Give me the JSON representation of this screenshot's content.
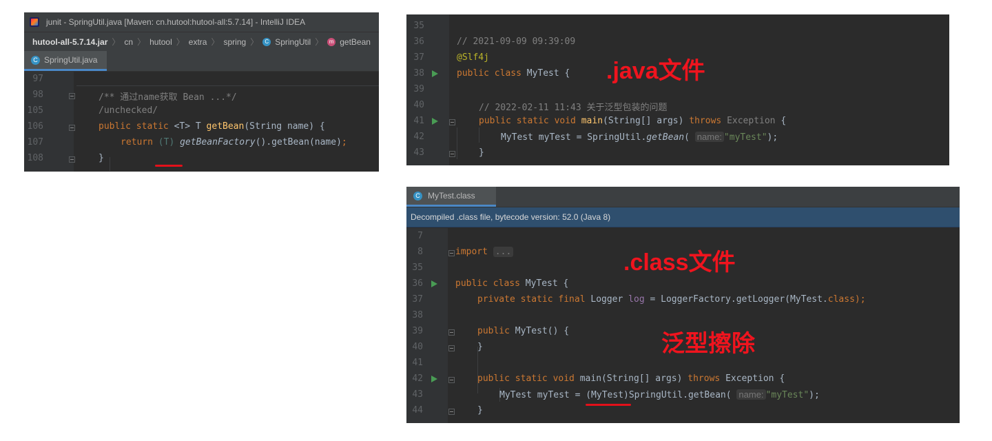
{
  "panel1": {
    "window_title": "junit - SpringUtil.java [Maven: cn.hutool:hutool-all:5.7.14] - IntelliJ IDEA",
    "breadcrumbs": [
      "hutool-all-5.7.14.jar",
      "cn",
      "hutool",
      "extra",
      "spring",
      "SpringUtil",
      "getBean"
    ],
    "tab_label": "SpringUtil.java",
    "lines": [
      {
        "num": "97"
      },
      {
        "num": "98",
        "comment": "/** 通过name获取 Bean ...*/"
      },
      {
        "num": "105",
        "comment": "/unchecked/"
      },
      {
        "num": "106",
        "kw1": "public static ",
        "gen": "<T>",
        "type": " T ",
        "fn": "getBean",
        "rest": "(String name) {"
      },
      {
        "num": "107",
        "kw": "return ",
        "cast": "(T) ",
        "it": "getBeanFactory",
        "rest": "().getBean(name)",
        "semi": ";"
      },
      {
        "num": "108",
        "rest": "}"
      }
    ]
  },
  "panel2": {
    "lines": [
      {
        "num": "35"
      },
      {
        "num": "36",
        "comment": "// 2021-09-09 09:39:09"
      },
      {
        "num": "37",
        "ann": "@Slf4j"
      },
      {
        "num": "38",
        "kw": "public class ",
        "rest": "MyTest {"
      },
      {
        "num": "39"
      },
      {
        "num": "40",
        "comment": "// 2022-02-11 11:43 关于泛型包装的问题"
      },
      {
        "num": "41",
        "kw": "public static void ",
        "fn": "main",
        "rest": "(String[] args) ",
        "kw2": "throws ",
        "exc": "Exception",
        "tail": " {"
      },
      {
        "num": "42",
        "pre": "MyTest myTest = SpringUtil.",
        "it": "getBean",
        "open": "(",
        "hint": "name:",
        "str": "\"myTest\"",
        "close": ");"
      },
      {
        "num": "43",
        "rest": "}"
      }
    ],
    "overlay": ".java文件"
  },
  "panel3": {
    "tab_label": "MyTest.class",
    "banner": "Decompiled .class file, bytecode version: 52.0 (Java 8)",
    "lines": [
      {
        "num": "7"
      },
      {
        "num": "8",
        "kw": "import ",
        "rest": "..."
      },
      {
        "num": "35"
      },
      {
        "num": "36",
        "kw": "public class ",
        "rest": "MyTest {"
      },
      {
        "num": "37",
        "kw": "private static final ",
        "mid": "Logger ",
        "field": "log",
        "tail": " = LoggerFactory.getLogger(MyTest.",
        "kw2": "class",
        "end": ");"
      },
      {
        "num": "38"
      },
      {
        "num": "39",
        "kw": "public ",
        "rest": "MyTest() {"
      },
      {
        "num": "40",
        "rest": "}"
      },
      {
        "num": "41"
      },
      {
        "num": "42",
        "kw": "public static void ",
        "fn": "main",
        "rest": "(String[] args) ",
        "kw2": "throws ",
        "exc": "Exception",
        "tail": " {"
      },
      {
        "num": "43",
        "pre": "MyTest myTest = ",
        "cast": "(MyTest)",
        "mid": "SpringUtil.getBean(",
        "hint": "name:",
        "str": "\"myTest\"",
        "close": ");"
      },
      {
        "num": "44",
        "rest": "}"
      }
    ],
    "overlay1": ".class文件",
    "overlay2": "泛型擦除"
  },
  "colors": {
    "background": "#2b2b2b",
    "keyword": "#cc7832",
    "string": "#6a8759",
    "annotation_red": "#f0141e"
  }
}
